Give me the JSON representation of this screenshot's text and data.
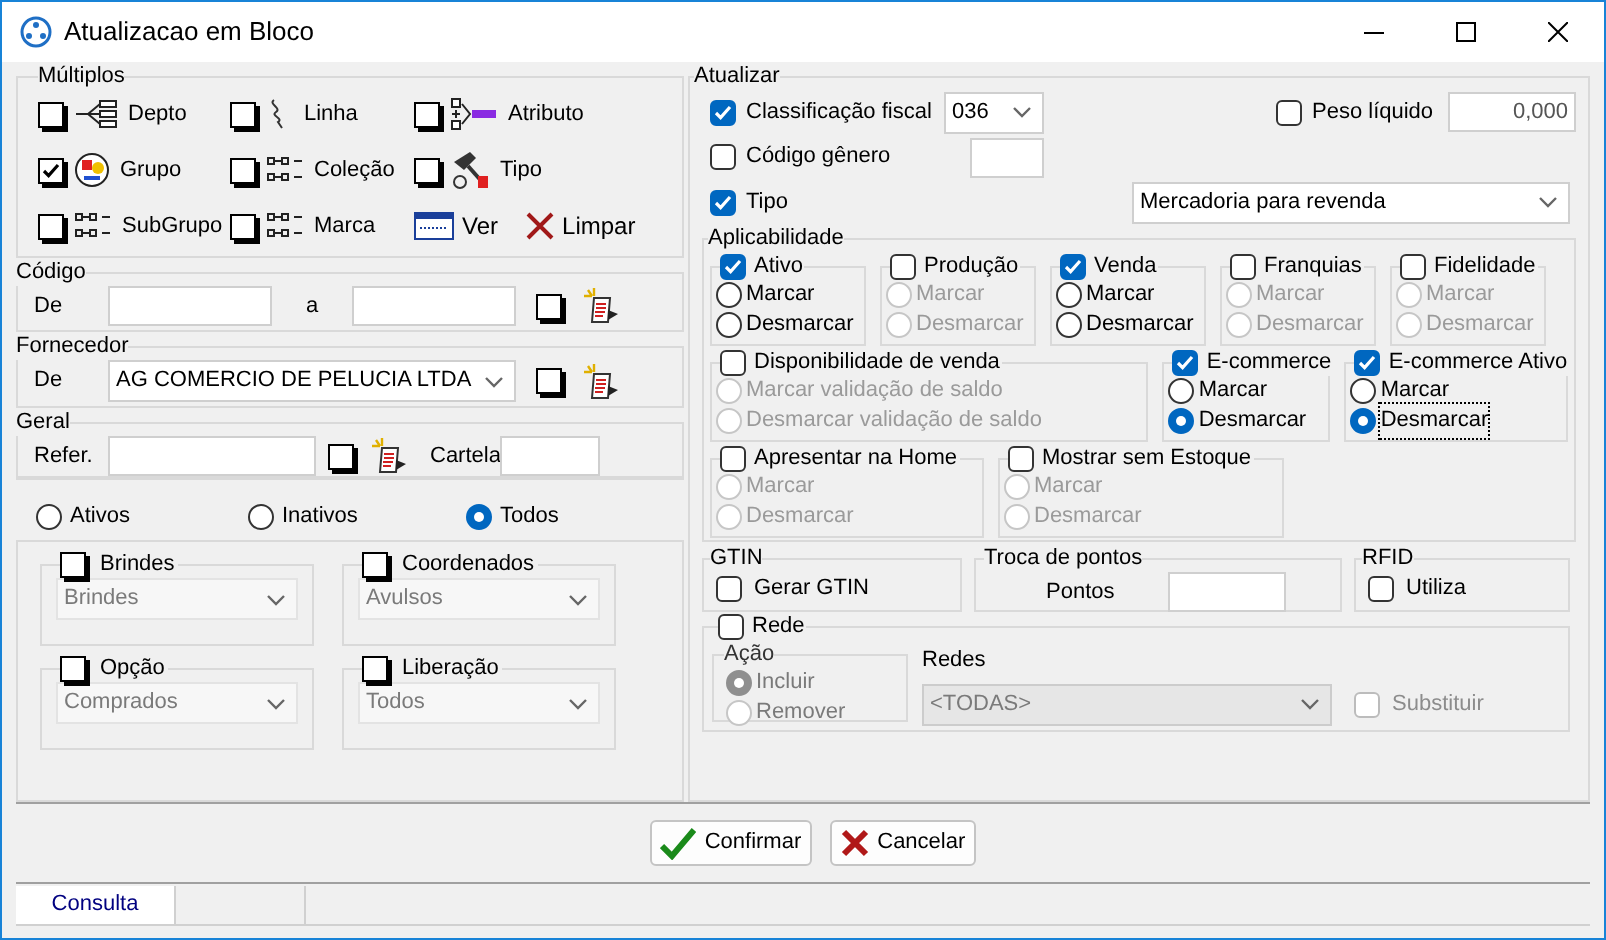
{
  "window": {
    "title": "Atualizacao em Bloco"
  },
  "multiplos": {
    "title": "Múltiplos",
    "items": [
      {
        "label": "Depto",
        "checked": false
      },
      {
        "label": "Linha",
        "checked": false
      },
      {
        "label": "Atributo",
        "checked": false
      },
      {
        "label": "Grupo",
        "checked": true
      },
      {
        "label": "Coleção",
        "checked": false
      },
      {
        "label": "Tipo",
        "checked": false
      },
      {
        "label": "SubGrupo",
        "checked": false
      },
      {
        "label": "Marca",
        "checked": false
      }
    ],
    "buttons": [
      {
        "label": "Ver",
        "kind": "view"
      },
      {
        "label": "Limpar",
        "kind": "clear"
      }
    ]
  },
  "codigo": {
    "title": "Código",
    "from_label": "De",
    "to_label": "a",
    "checked": false
  },
  "fornecedor": {
    "title": "Fornecedor",
    "label": "De",
    "value": "AG COMERCIO DE PELUCIA LTDA",
    "checked": false
  },
  "geral": {
    "title": "Geral",
    "ref_label": "Refer.",
    "checked": false,
    "cartela_label": "Cartela"
  },
  "status_filter": [
    {
      "label": "Ativos",
      "selected": false
    },
    {
      "label": "Inativos",
      "selected": false
    },
    {
      "label": "Todos",
      "selected": true
    }
  ],
  "filters": [
    {
      "label": "Brindes",
      "checked": false,
      "value": "Brindes"
    },
    {
      "label": "Coordenados",
      "checked": false,
      "value": "Avulsos"
    },
    {
      "label": "Opção",
      "checked": false,
      "value": "Comprados"
    },
    {
      "label": "Liberação",
      "checked": false,
      "value": "Todos"
    }
  ],
  "atualizar": {
    "title": "Atualizar",
    "classificacao": {
      "label": "Classificação fiscal",
      "checked": true,
      "value": "036"
    },
    "peso": {
      "label": "Peso líquido",
      "checked": false,
      "value": "0,000"
    },
    "codigo_genero": {
      "label": "Código gênero",
      "checked": false
    },
    "tipo": {
      "label": "Tipo",
      "checked": true,
      "value": "Mercadoria para revenda"
    }
  },
  "aplicabilidade": {
    "title": "Aplicabilidade",
    "rows": [
      {
        "groups": [
          {
            "label": "Ativo",
            "checked": true,
            "options": [
              {
                "label": "Marcar",
                "selected": false
              },
              {
                "label": "Desmarcar",
                "selected": false
              }
            ]
          },
          {
            "label": "Produção",
            "checked": false,
            "options": [
              {
                "label": "Marcar",
                "selected": false
              },
              {
                "label": "Desmarcar",
                "selected": false
              }
            ]
          },
          {
            "label": "Venda",
            "checked": true,
            "options": [
              {
                "label": "Marcar",
                "selected": false
              },
              {
                "label": "Desmarcar",
                "selected": false
              }
            ]
          },
          {
            "label": "Franquias",
            "checked": false,
            "options": [
              {
                "label": "Marcar",
                "selected": false
              },
              {
                "label": "Desmarcar",
                "selected": false
              }
            ]
          },
          {
            "label": "Fidelidade",
            "checked": false,
            "options": [
              {
                "label": "Marcar",
                "selected": false
              },
              {
                "label": "Desmarcar",
                "selected": false
              }
            ]
          }
        ]
      },
      {
        "groups": [
          {
            "label": "Disponibilidade de venda",
            "checked": false,
            "options": [
              {
                "label": "Marcar validação de saldo",
                "selected": false
              },
              {
                "label": "Desmarcar validação de saldo",
                "selected": false
              }
            ]
          },
          {
            "label": "E-commerce",
            "checked": true,
            "options": [
              {
                "label": "Marcar",
                "selected": false
              },
              {
                "label": "Desmarcar",
                "selected": true
              }
            ]
          },
          {
            "label": "E-commerce Ativo",
            "checked": true,
            "options": [
              {
                "label": "Marcar",
                "selected": false
              },
              {
                "label": "Desmarcar",
                "selected": true,
                "focused": true
              }
            ]
          }
        ]
      },
      {
        "groups": [
          {
            "label": "Apresentar na Home",
            "checked": false,
            "options": [
              {
                "label": "Marcar",
                "selected": false
              },
              {
                "label": "Desmarcar",
                "selected": false
              }
            ]
          },
          {
            "label": "Mostrar sem Estoque",
            "checked": false,
            "options": [
              {
                "label": "Marcar",
                "selected": false
              },
              {
                "label": "Desmarcar",
                "selected": false
              }
            ]
          }
        ]
      }
    ]
  },
  "gtin": {
    "title": "GTIN",
    "label": "Gerar GTIN",
    "checked": false
  },
  "troca": {
    "title": "Troca de pontos",
    "label": "Pontos"
  },
  "rfid": {
    "title": "RFID",
    "label": "Utiliza",
    "checked": false
  },
  "rede": {
    "label": "Rede",
    "checked": false,
    "acao_title": "Ação",
    "options": [
      {
        "label": "Incluir",
        "selected": true
      },
      {
        "label": "Remover",
        "selected": false
      }
    ],
    "redes_label": "Redes",
    "redes_value": "<TODAS>",
    "substituir": {
      "label": "Substituir",
      "checked": false
    }
  },
  "buttons": [
    {
      "label": "Confirmar",
      "kind": "confirm"
    },
    {
      "label": "Cancelar",
      "kind": "cancel"
    }
  ],
  "status_bar": [
    "Consulta"
  ]
}
